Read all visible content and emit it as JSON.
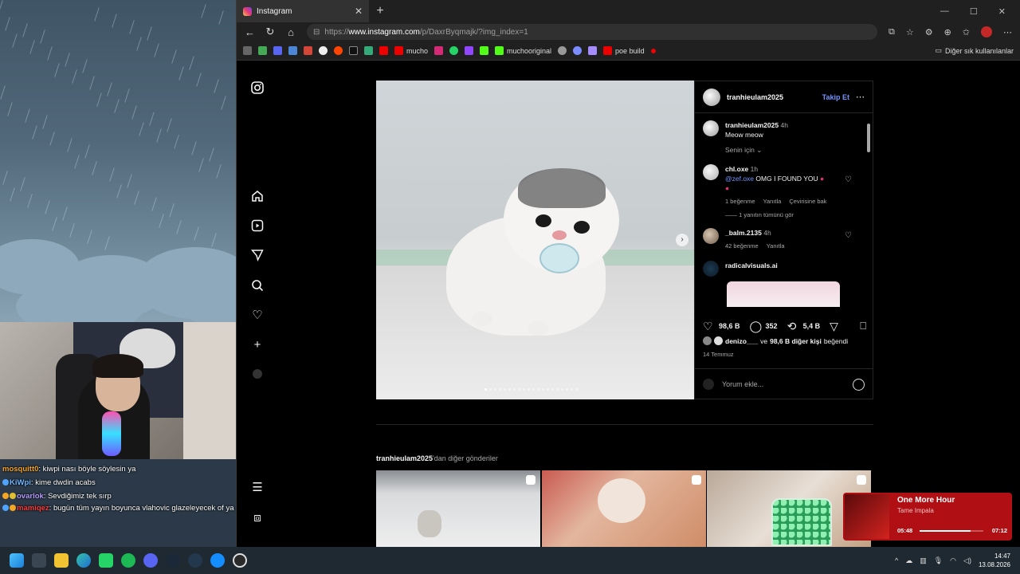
{
  "stream": {
    "chat": [
      {
        "user": "mosquitt0",
        "color": "#f5a623",
        "message": "kiwpi nası böyle söylesin ya"
      },
      {
        "user": "KiWpi",
        "color": "#6fb8ff",
        "message": "kime dwdin acabs"
      },
      {
        "user": "ovarlok",
        "color": "#b79cff",
        "message": "Sevdiğimiz tek sırp"
      },
      {
        "user": "mamiqez",
        "color": "#ff3b3b",
        "message": "bugün tüm yayın boyunca vlahovic glazeleyecek of ya"
      }
    ]
  },
  "browser": {
    "tab_title": "Instagram",
    "url_prefix": "https://",
    "url_domain": "www.instagram.com",
    "url_path": "/p/DaxrByqmajk/?img_index=1",
    "bookmarks": [
      "mucho",
      "muchooriginal",
      "poe build"
    ],
    "bookmarks_folder": "Diğer sık kullanılanlar"
  },
  "post": {
    "username": "tranhieulam2025",
    "follow_label": "Takip Et",
    "caption_user": "tranhieulam2025",
    "caption_time": "4h",
    "caption": "Meow meow",
    "for_you": "Senin için",
    "comments": [
      {
        "user": "chl.oxe",
        "time": "1h",
        "mention": "@zef.oxe",
        "text": "OMG I FOUND YOU",
        "likes": "1 beğenme",
        "reply": "Yanıtla",
        "translate": "Çevirisine bak",
        "see_replies": "1 yanıtın tümünü gör"
      },
      {
        "user": "_balm.2135",
        "time": "4h",
        "likes": "42 beğenme",
        "reply": "Yanıtla"
      },
      {
        "user": "radicalvisuals.ai"
      }
    ],
    "like_count": "98,6 B",
    "comment_count": "352",
    "repost_count": "5,4 B",
    "liked_by_user": "denizo___",
    "liked_by_middle": "ve",
    "liked_by_rest": "98,6 B diğer kişi",
    "liked_by_suffix": "beğendi",
    "date": "14 Temmuz",
    "comment_placeholder": "Yorum ekle...",
    "carousel_active_index": 0,
    "carousel_total": 20
  },
  "more_posts": {
    "user": "tranhieulam2025",
    "suffix": "'dan diğer gönderiler"
  },
  "now_playing": {
    "song": "One More Hour",
    "artist": "Tame Impala",
    "elapsed": "05:48",
    "total": "07:12",
    "progress": 0.8
  },
  "clock": {
    "time": "14:47",
    "date": "13.08.2026"
  }
}
